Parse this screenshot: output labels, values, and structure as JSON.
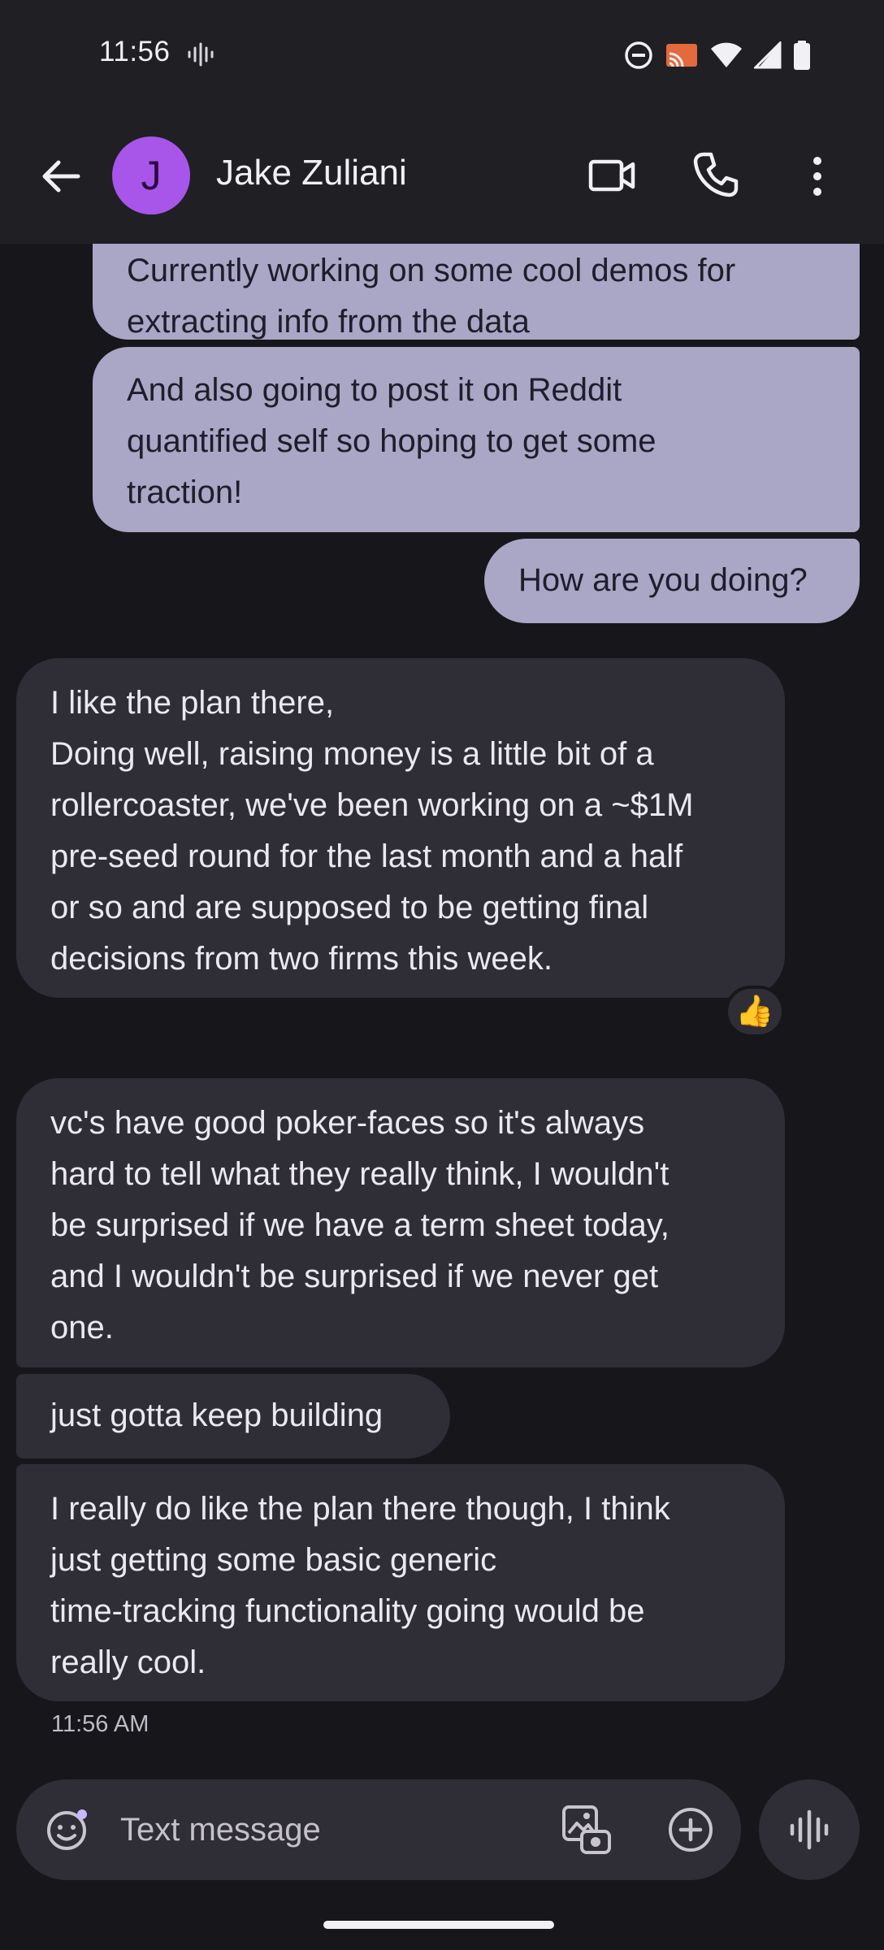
{
  "status_bar": {
    "time": "11:56"
  },
  "header": {
    "avatar_initial": "J",
    "contact_name": "Jake Zuliani"
  },
  "messages": [
    {
      "direction": "outgoing",
      "text": "Currently working on some cool demos for\nextracting info from the data"
    },
    {
      "direction": "outgoing",
      "text": "And also going to post it on Reddit\nquantified self so hoping to get some\ntraction!"
    },
    {
      "direction": "outgoing",
      "text": "How are you doing?"
    },
    {
      "direction": "incoming",
      "text": "I like the plan there,\nDoing well, raising money is a little bit of a\nrollercoaster, we've been working on a ~$1M\npre-seed round for the last month and a half\nor so and are supposed to be getting final\ndecisions from two firms this week."
    },
    {
      "direction": "incoming",
      "text": "vc's have good poker-faces so it's always\nhard to tell what they really think, I wouldn't\nbe surprised if we have a term sheet today,\nand I wouldn't be surprised if we never get\none."
    },
    {
      "direction": "incoming",
      "text": "just gotta keep building"
    },
    {
      "direction": "incoming",
      "text": "I really do like the plan there though, I think\njust getting some basic generic\ntime-tracking functionality going would be\nreally cool."
    }
  ],
  "reaction": "👍",
  "last_timestamp": "11:56 AM",
  "compose": {
    "placeholder": "Text message"
  },
  "icons": {
    "back": "arrow-back-icon",
    "video": "video-call-icon",
    "call": "phone-icon",
    "more": "more-vert-icon",
    "emoji": "emoji-icon",
    "gallery": "gallery-icon",
    "add": "add-circle-icon",
    "voice": "voice-wave-icon"
  },
  "colors": {
    "avatar": "#a855ea",
    "outgoing_bubble": "#aaa6c6",
    "incoming_bubble": "#2f2d35",
    "background": "#17161b"
  }
}
